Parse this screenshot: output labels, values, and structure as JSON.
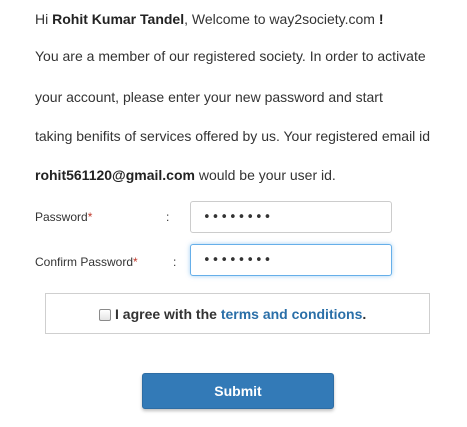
{
  "greeting": {
    "prefix": "Hi ",
    "name": "Rohit Kumar Tandel",
    "middle": ", Welcome to way2society.com ",
    "suffix": "!"
  },
  "message": {
    "line1": "You are a member of our registered society. In order to activate",
    "line2": "your account, please enter your new password and start",
    "line3": "taking benifits of services offered by us. Your registered email id",
    "email": "rohit561120@gmail.com",
    "line4_rest": " would be your user id."
  },
  "form": {
    "password_label": "Password",
    "confirm_label": "Confirm Password",
    "required_mark": "*",
    "colon": ":",
    "password_value": "password",
    "confirm_value": "password"
  },
  "agree": {
    "text": "I agree with the ",
    "link_text": "terms and conditions",
    "period": ".",
    "checked": false
  },
  "submit_label": "Submit"
}
